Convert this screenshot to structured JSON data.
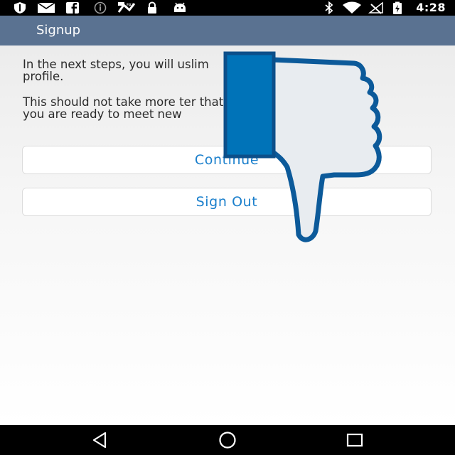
{
  "status_bar": {
    "time": "4:28",
    "left_icons": [
      "shield-icon",
      "mail-icon",
      "facebook-icon",
      "info-icon",
      "fax-icon",
      "lock-icon",
      "android-icon"
    ],
    "right_icons": [
      "bluetooth-icon",
      "wifi-icon",
      "no-signal-icon",
      "battery-charging-icon"
    ]
  },
  "app_bar": {
    "title": "Signup"
  },
  "content": {
    "paragraph_1": "In the next steps, you will                                uslim\nprofile.",
    "paragraph_2": "This should not take more                                  ter that\nyou are ready to meet new",
    "continue_label": "Continue",
    "sign_out_label": "Sign Out"
  },
  "overlay": {
    "icon": "thumbs-down-icon",
    "fill": "#e8ecf0",
    "stroke": "#0c5a9a",
    "cuff": "#0073b8"
  },
  "nav_bar": {
    "icons": [
      "back-icon",
      "home-icon",
      "recents-icon"
    ]
  },
  "colors": {
    "app_bar": "#5a7291",
    "accent": "#1a7fcc",
    "status_bar": "#000000"
  }
}
